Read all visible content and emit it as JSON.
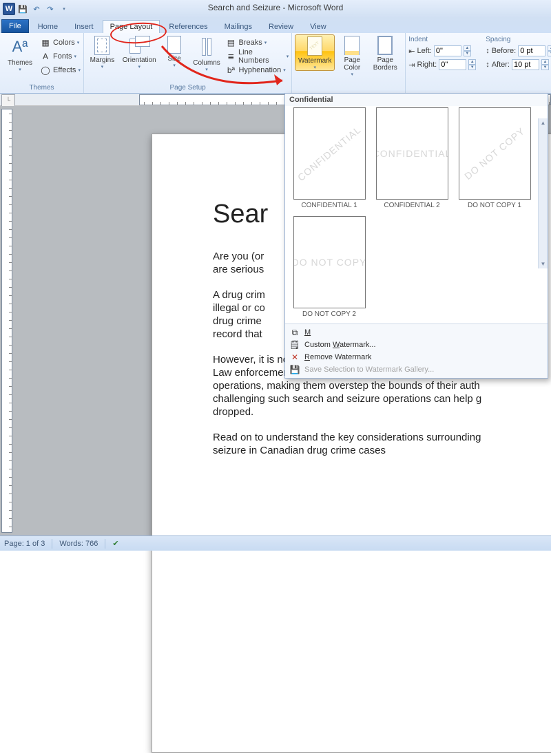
{
  "window_title": "Search and Seizure  -  Microsoft Word",
  "tabs": {
    "file": "File",
    "items": [
      "Home",
      "Insert",
      "Page Layout",
      "References",
      "Mailings",
      "Review",
      "View"
    ],
    "active_index": 2
  },
  "themes_group": {
    "label": "Themes",
    "themes_btn": "Themes",
    "colors": "Colors",
    "fonts": "Fonts",
    "effects": "Effects"
  },
  "page_setup_group": {
    "label": "Page Setup",
    "margins": "Margins",
    "orientation": "Orientation",
    "size": "Size",
    "columns": "Columns",
    "breaks": "Breaks",
    "line_numbers": "Line Numbers",
    "hyphenation": "Hyphenation"
  },
  "page_bg_group": {
    "watermark": "Watermark",
    "page_color": "Page Color",
    "page_borders": "Page Borders"
  },
  "paragraph_group": {
    "indent_label": "Indent",
    "left_label": "Left:",
    "left_value": "0\"",
    "right_label": "Right:",
    "right_value": "0\"",
    "spacing_label": "Spacing",
    "before_label": "Before:",
    "before_value": "0 pt",
    "after_label": "After:",
    "after_value": "10 pt"
  },
  "watermark_panel": {
    "header": "Confidential",
    "items": [
      {
        "watermark_text": "CONFIDENTIAL",
        "caption": "CONFIDENTIAL 1"
      },
      {
        "watermark_text": "CONFIDENTIAL",
        "caption": "CONFIDENTIAL 2"
      },
      {
        "watermark_text": "DO NOT COPY",
        "caption": "DO NOT COPY 1"
      },
      {
        "watermark_text": "DO NOT COPY",
        "caption": "DO NOT COPY 2"
      }
    ],
    "menu": {
      "more": "More Watermarks from Office.com",
      "custom": "Custom Watermark...",
      "remove": "Remove Watermark",
      "save_gallery": "Save Selection to Watermark Gallery..."
    }
  },
  "document": {
    "heading": "Sear",
    "p1": "Are you (or",
    "p1b": "are serious",
    "p2a": "A drug crim",
    "p2b": "illegal or co",
    "p2c": "drug crime",
    "p2d": "record that",
    "p3": "However, it is not all doom and gloom if you are charged w",
    "p3b": "Law enforcement officers are often overzealous with searc",
    "p3c": "operations, making them overstep the bounds of their auth",
    "p3d": "challenging such search and seizure operations can help g",
    "p3e": "dropped.",
    "p4": "Read on to understand the key considerations surrounding",
    "p4b": "seizure in Canadian drug crime cases"
  },
  "statusbar": {
    "page": "Page: 1 of 3",
    "words": "Words: 766"
  }
}
